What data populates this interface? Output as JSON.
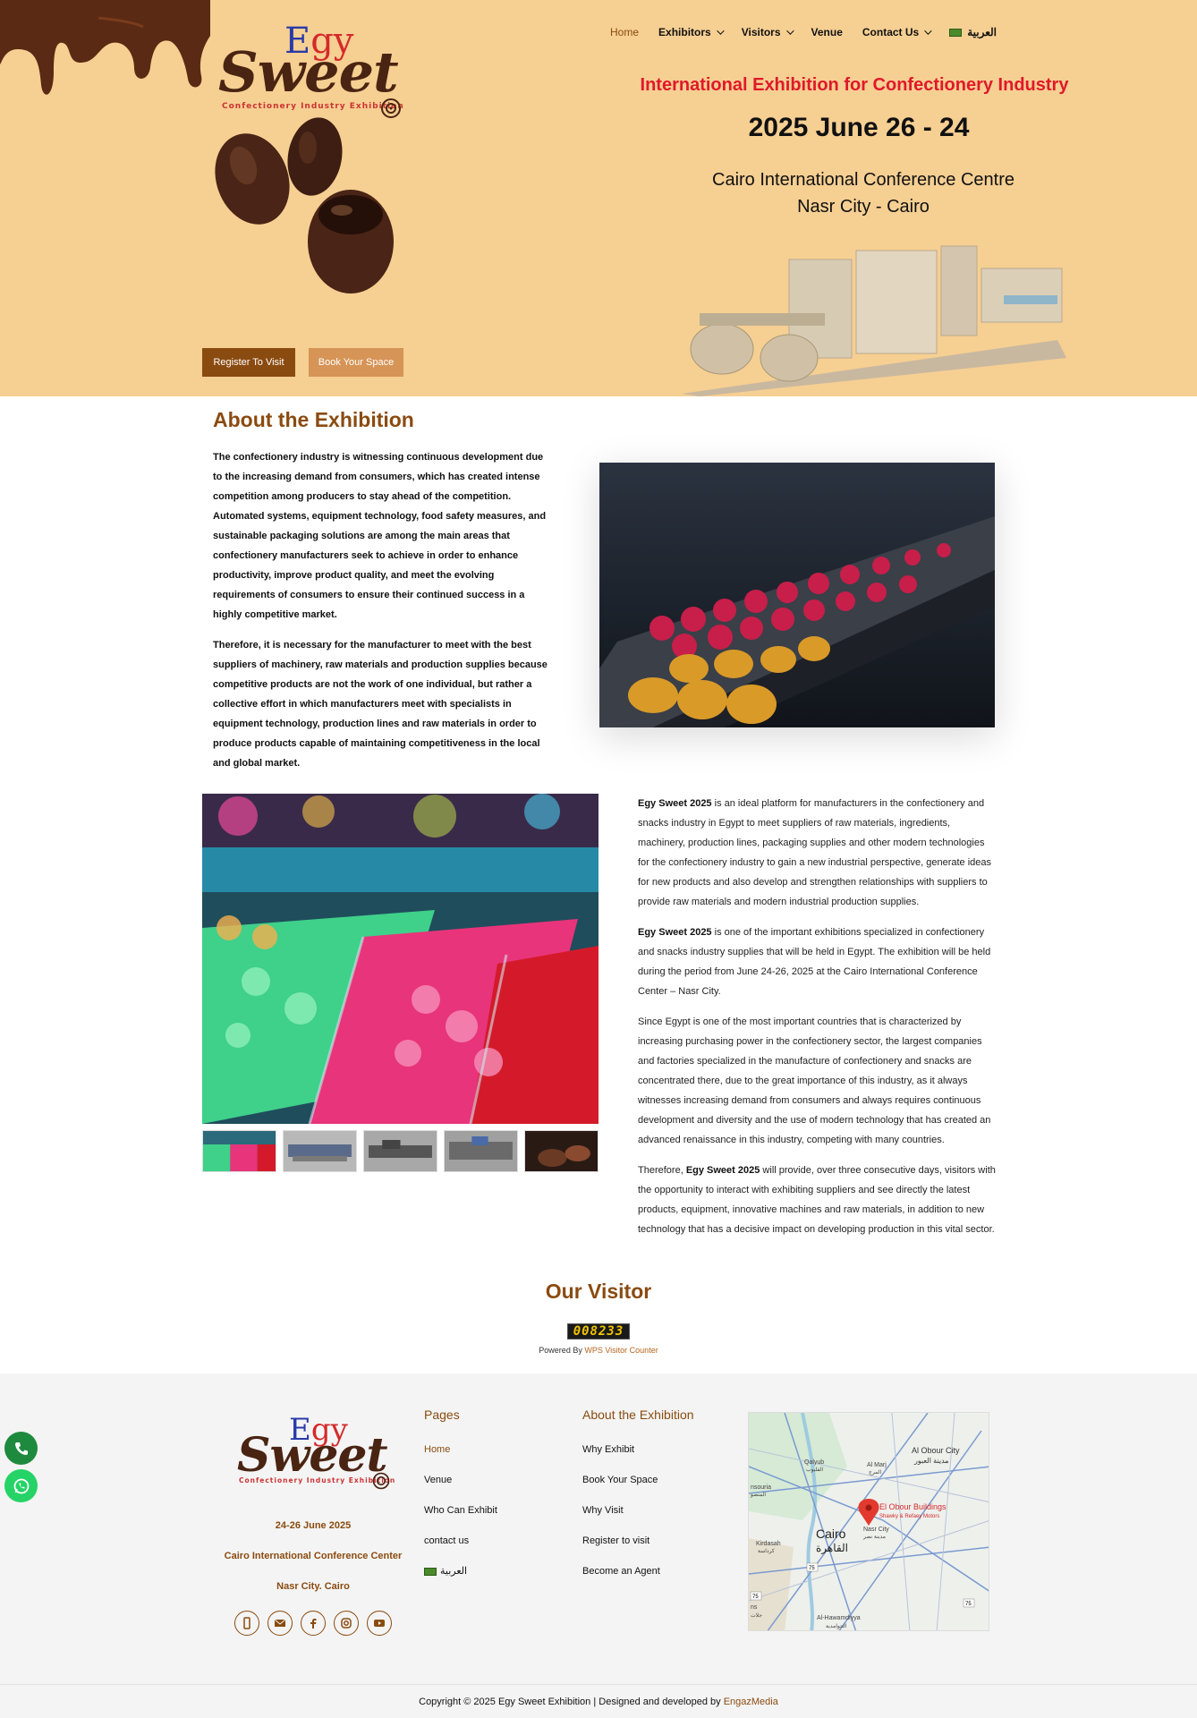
{
  "nav": {
    "items": [
      {
        "label": "Home",
        "active": true,
        "dropdown": false
      },
      {
        "label": "Exhibitors",
        "active": false,
        "dropdown": true
      },
      {
        "label": "Visitors",
        "active": false,
        "dropdown": true
      },
      {
        "label": "Venue",
        "active": false,
        "dropdown": false
      },
      {
        "label": "Contact Us",
        "active": false,
        "dropdown": true
      }
    ],
    "language": "العربية"
  },
  "logo": {
    "egy_e": "E",
    "egy_gy": "gy",
    "sweet": "Sweet",
    "tagline": "Confectionery Industry Exhibition"
  },
  "hero": {
    "title": "International Exhibition for Confectionery Industry",
    "date": "2025 June 26 - 24",
    "venue_line1": "Cairo International Conference Centre",
    "venue_line2": "Nasr City - Cairo",
    "register_button": "Register To Visit",
    "book_button": "Book Your Space"
  },
  "about": {
    "heading": "About the Exhibition",
    "para1": "The confectionery industry is witnessing continuous development due to the increasing demand from consumers, which has created intense competition among producers to stay ahead of the competition. Automated systems, equipment technology, food safety measures, and sustainable packaging solutions are among the main areas that confectionery manufacturers seek to achieve in order to enhance productivity, improve product quality, and meet the evolving requirements of consumers to ensure their continued success in a highly competitive market.",
    "para2": "Therefore, it is necessary for the manufacturer to meet with the best suppliers of machinery, raw materials and production supplies because competitive products are not the work of one individual, but rather a collective effort in which manufacturers meet with specialists in equipment technology, production lines and raw materials in order to produce products capable of maintaining competitiveness in the local and global market."
  },
  "body": {
    "brand": "Egy Sweet 2025",
    "p1_rest": " is an ideal platform for manufacturers in the confectionery and snacks industry in Egypt to meet suppliers of raw materials, ingredients, machinery, production lines, packaging supplies and other modern technologies for the confectionery industry to gain a new industrial perspective, generate ideas for new products and also develop and strengthen relationships with suppliers to provide raw materials and modern industrial production supplies.",
    "p2_rest": " is one of the important exhibitions specialized in confectionery and snacks industry supplies that will be held in Egypt. The exhibition will be held during the period from June 24-26, 2025 at the Cairo International Conference Center – Nasr City.",
    "p3": "Since Egypt is one of the most important countries that is characterized by increasing purchasing power in the confectionery sector, the largest companies and factories specialized in the manufacture of confectionery and snacks are concentrated there, due to the great importance of this industry, as it always witnesses increasing demand from consumers and always requires continuous development and diversity and the use of modern technology that has created an advanced renaissance in this industry, competing with many countries.",
    "p4_start": "Therefore, ",
    "p4_rest": " will provide, over three consecutive days, visitors with the opportunity to interact with exhibiting suppliers and see directly the latest products, equipment, innovative machines and raw materials, in addition to new technology that has a decisive impact on developing production in this vital sector."
  },
  "visitor": {
    "heading": "Our Visitor",
    "count": "008233",
    "powered_prefix": "Powered By ",
    "powered_link": "WPS Visitor Counter"
  },
  "footer": {
    "dates": "24-26 June 2025",
    "venue": "Cairo International Conference Center",
    "city": "Nasr City. Cairo",
    "pages_heading": "Pages",
    "pages": [
      "Home",
      "Venue",
      "Who Can Exhibit",
      "contact us",
      "العربية"
    ],
    "about_heading": "About the Exhibition",
    "about_links": [
      "Why Exhibit",
      "Book Your Space",
      "Why Visit",
      "Register to visit",
      "Become an Agent"
    ],
    "map": {
      "city": "Cairo",
      "city_ar": "القاهرة",
      "pin_label": "El Obour Buildings",
      "pin_sub": "Shawky & Refaey Motors",
      "places": [
        "Al Obour City",
        "مدينة العبور",
        "Qalyub",
        "القليوب",
        "Al Marj",
        "المرج",
        "Nasr City",
        "مدينة نصر",
        "Kirdasah",
        "كرداسة",
        "Al-Hawamdiyya",
        "الحوامدية",
        "nsouria",
        "المنصو",
        "ns",
        "جلات"
      ],
      "roads": [
        "75",
        "75",
        "75"
      ]
    }
  },
  "copyright": {
    "text": "Copyright © 2025 Egy Sweet Exhibition | Designed and developed by ",
    "link": "EngazMedia"
  },
  "colors": {
    "hero_bg": "#f6cf92",
    "brand_brown": "#8a4b10",
    "accent_red": "#e0192a",
    "button_light": "#d69456",
    "whatsapp_green": "#25d366",
    "phone_green": "#1e8a3e"
  }
}
